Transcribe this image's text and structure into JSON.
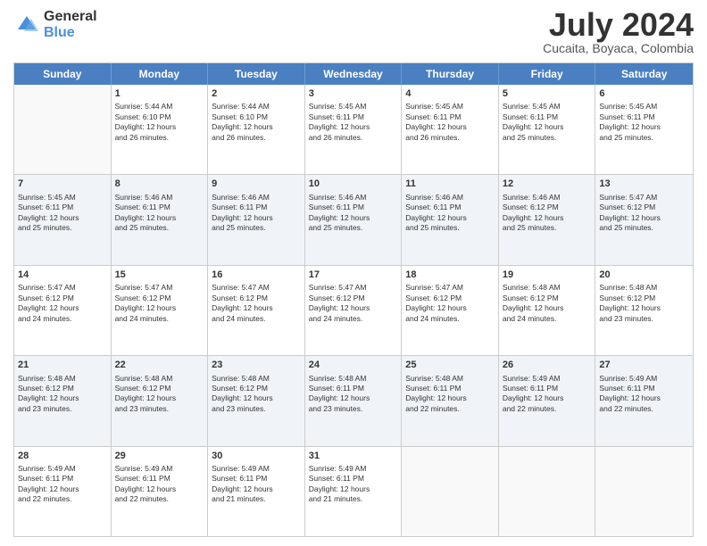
{
  "header": {
    "logo": {
      "line1": "General",
      "line2": "Blue"
    },
    "title": "July 2024",
    "location": "Cucaita, Boyaca, Colombia"
  },
  "calendar": {
    "days_of_week": [
      "Sunday",
      "Monday",
      "Tuesday",
      "Wednesday",
      "Thursday",
      "Friday",
      "Saturday"
    ],
    "weeks": [
      {
        "alt": false,
        "cells": [
          {
            "day": "",
            "info": ""
          },
          {
            "day": "1",
            "info": "Sunrise: 5:44 AM\nSunset: 6:10 PM\nDaylight: 12 hours\nand 26 minutes."
          },
          {
            "day": "2",
            "info": "Sunrise: 5:44 AM\nSunset: 6:10 PM\nDaylight: 12 hours\nand 26 minutes."
          },
          {
            "day": "3",
            "info": "Sunrise: 5:45 AM\nSunset: 6:11 PM\nDaylight: 12 hours\nand 26 minutes."
          },
          {
            "day": "4",
            "info": "Sunrise: 5:45 AM\nSunset: 6:11 PM\nDaylight: 12 hours\nand 26 minutes."
          },
          {
            "day": "5",
            "info": "Sunrise: 5:45 AM\nSunset: 6:11 PM\nDaylight: 12 hours\nand 25 minutes."
          },
          {
            "day": "6",
            "info": "Sunrise: 5:45 AM\nSunset: 6:11 PM\nDaylight: 12 hours\nand 25 minutes."
          }
        ]
      },
      {
        "alt": true,
        "cells": [
          {
            "day": "7",
            "info": "Sunrise: 5:45 AM\nSunset: 6:11 PM\nDaylight: 12 hours\nand 25 minutes."
          },
          {
            "day": "8",
            "info": "Sunrise: 5:46 AM\nSunset: 6:11 PM\nDaylight: 12 hours\nand 25 minutes."
          },
          {
            "day": "9",
            "info": "Sunrise: 5:46 AM\nSunset: 6:11 PM\nDaylight: 12 hours\nand 25 minutes."
          },
          {
            "day": "10",
            "info": "Sunrise: 5:46 AM\nSunset: 6:11 PM\nDaylight: 12 hours\nand 25 minutes."
          },
          {
            "day": "11",
            "info": "Sunrise: 5:46 AM\nSunset: 6:11 PM\nDaylight: 12 hours\nand 25 minutes."
          },
          {
            "day": "12",
            "info": "Sunrise: 5:46 AM\nSunset: 6:12 PM\nDaylight: 12 hours\nand 25 minutes."
          },
          {
            "day": "13",
            "info": "Sunrise: 5:47 AM\nSunset: 6:12 PM\nDaylight: 12 hours\nand 25 minutes."
          }
        ]
      },
      {
        "alt": false,
        "cells": [
          {
            "day": "14",
            "info": "Sunrise: 5:47 AM\nSunset: 6:12 PM\nDaylight: 12 hours\nand 24 minutes."
          },
          {
            "day": "15",
            "info": "Sunrise: 5:47 AM\nSunset: 6:12 PM\nDaylight: 12 hours\nand 24 minutes."
          },
          {
            "day": "16",
            "info": "Sunrise: 5:47 AM\nSunset: 6:12 PM\nDaylight: 12 hours\nand 24 minutes."
          },
          {
            "day": "17",
            "info": "Sunrise: 5:47 AM\nSunset: 6:12 PM\nDaylight: 12 hours\nand 24 minutes."
          },
          {
            "day": "18",
            "info": "Sunrise: 5:47 AM\nSunset: 6:12 PM\nDaylight: 12 hours\nand 24 minutes."
          },
          {
            "day": "19",
            "info": "Sunrise: 5:48 AM\nSunset: 6:12 PM\nDaylight: 12 hours\nand 24 minutes."
          },
          {
            "day": "20",
            "info": "Sunrise: 5:48 AM\nSunset: 6:12 PM\nDaylight: 12 hours\nand 23 minutes."
          }
        ]
      },
      {
        "alt": true,
        "cells": [
          {
            "day": "21",
            "info": "Sunrise: 5:48 AM\nSunset: 6:12 PM\nDaylight: 12 hours\nand 23 minutes."
          },
          {
            "day": "22",
            "info": "Sunrise: 5:48 AM\nSunset: 6:12 PM\nDaylight: 12 hours\nand 23 minutes."
          },
          {
            "day": "23",
            "info": "Sunrise: 5:48 AM\nSunset: 6:12 PM\nDaylight: 12 hours\nand 23 minutes."
          },
          {
            "day": "24",
            "info": "Sunrise: 5:48 AM\nSunset: 6:11 PM\nDaylight: 12 hours\nand 23 minutes."
          },
          {
            "day": "25",
            "info": "Sunrise: 5:48 AM\nSunset: 6:11 PM\nDaylight: 12 hours\nand 22 minutes."
          },
          {
            "day": "26",
            "info": "Sunrise: 5:49 AM\nSunset: 6:11 PM\nDaylight: 12 hours\nand 22 minutes."
          },
          {
            "day": "27",
            "info": "Sunrise: 5:49 AM\nSunset: 6:11 PM\nDaylight: 12 hours\nand 22 minutes."
          }
        ]
      },
      {
        "alt": false,
        "cells": [
          {
            "day": "28",
            "info": "Sunrise: 5:49 AM\nSunset: 6:11 PM\nDaylight: 12 hours\nand 22 minutes."
          },
          {
            "day": "29",
            "info": "Sunrise: 5:49 AM\nSunset: 6:11 PM\nDaylight: 12 hours\nand 22 minutes."
          },
          {
            "day": "30",
            "info": "Sunrise: 5:49 AM\nSunset: 6:11 PM\nDaylight: 12 hours\nand 21 minutes."
          },
          {
            "day": "31",
            "info": "Sunrise: 5:49 AM\nSunset: 6:11 PM\nDaylight: 12 hours\nand 21 minutes."
          },
          {
            "day": "",
            "info": ""
          },
          {
            "day": "",
            "info": ""
          },
          {
            "day": "",
            "info": ""
          }
        ]
      }
    ]
  }
}
